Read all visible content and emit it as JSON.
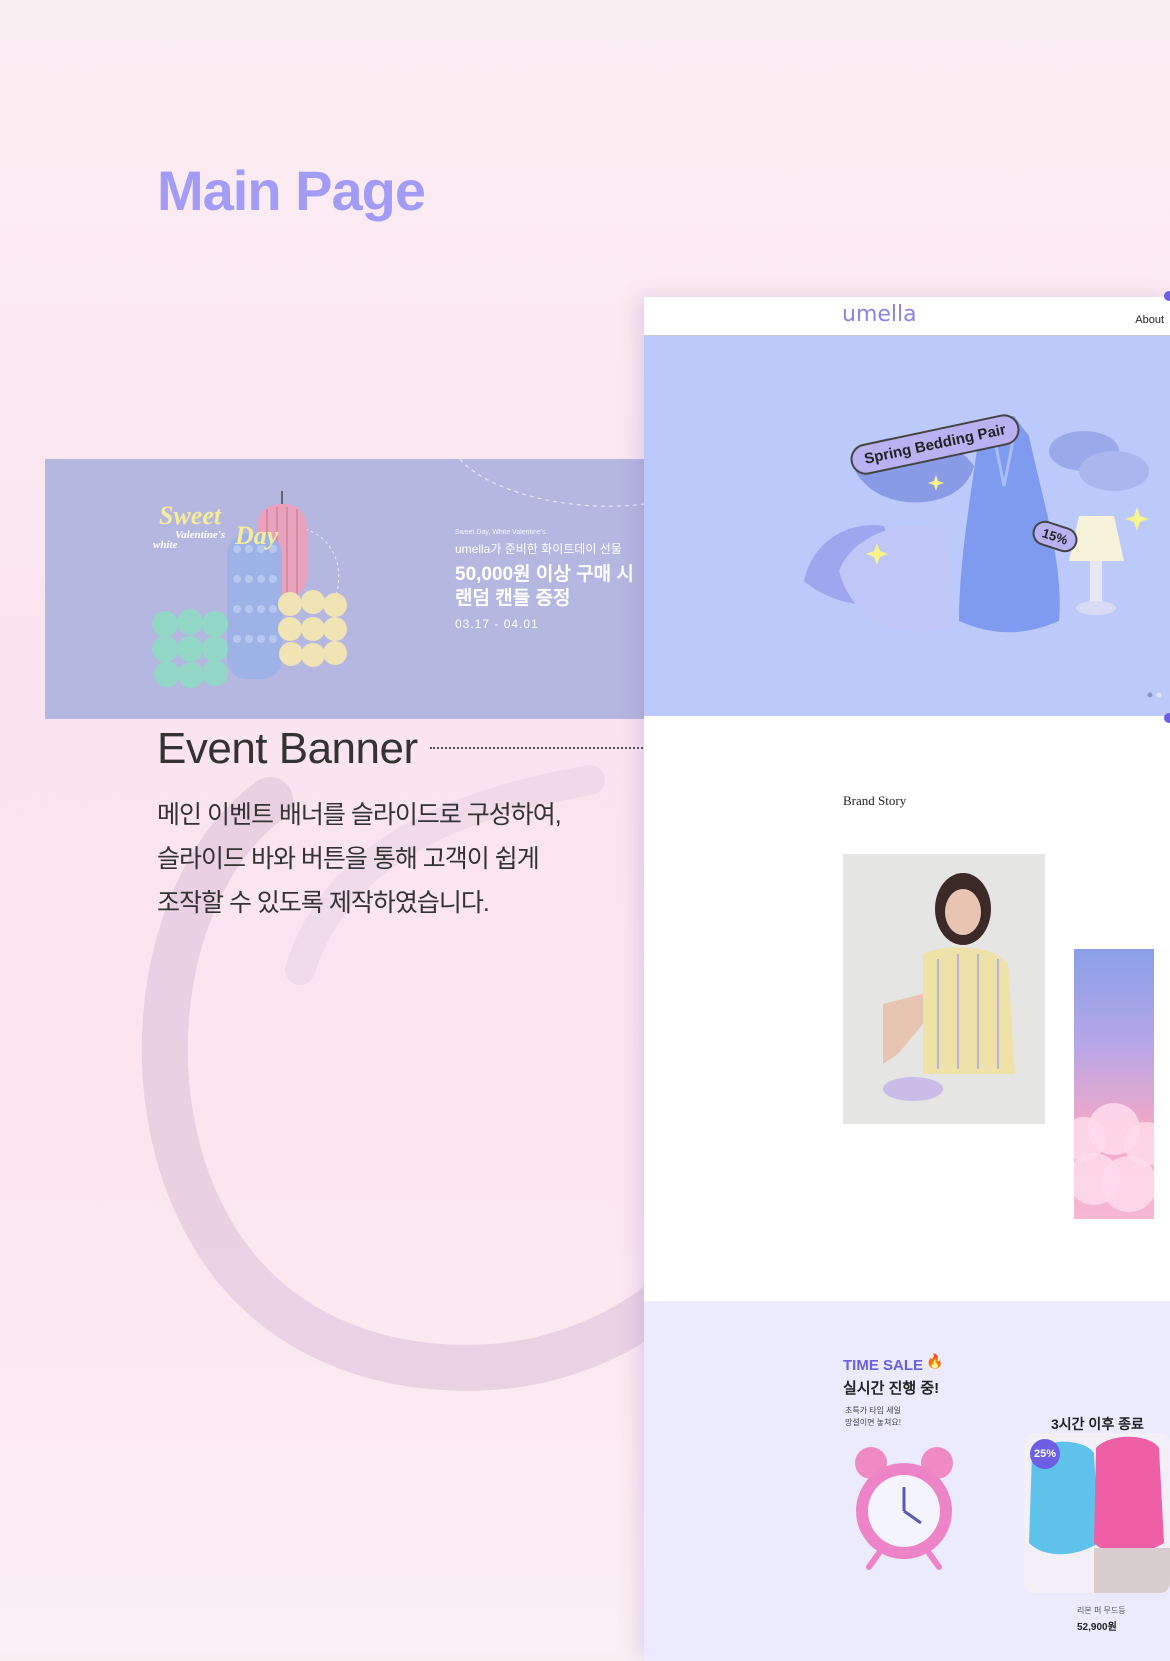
{
  "page": {
    "heading": "Main Page"
  },
  "event_banner": {
    "script_title_1": "Sweet",
    "script_title_2": "Day",
    "script_valentine": "Valentine's",
    "script_white": "white",
    "small_caption": "Sweet Day, White Valentine's",
    "subtitle": "umella가 준비한 화이트데이 선물",
    "headline_1": "50,000원 이상 구매 시",
    "headline_2": "랜덤 캔들 증정",
    "date_range": "03.17 - 04.01"
  },
  "section": {
    "title": "Event Banner",
    "description_1": "메인 이벤트 배너를 슬라이드로 구성하여,",
    "description_2": "슬라이드 바와 버튼을 통해 고객이 쉽게",
    "description_3": "조작할 수 있도록 제작하였습니다."
  },
  "mockup": {
    "logo": "umella",
    "nav_about": "About",
    "hero_pill": "Spring Bedding Pair",
    "hero_badge": "15%",
    "brand_story": "Brand Story",
    "time_sale": {
      "title": "TIME SALE",
      "subtitle": "실시간 진행 중!",
      "note_1": "초특가 타임 세일",
      "note_2": "망설이면 놓쳐요!",
      "ends": "3시간 이후 종료",
      "discount_badge": "25%",
      "product_name": "리본 퍼 무드등",
      "product_price": "52,900원"
    }
  },
  "colors": {
    "heading": "#a29cf6",
    "event_bg": "#b4b7df",
    "hero_bg": "#bccafb",
    "accent": "#6c5fe4",
    "timesale_bg": "#ecebfd"
  }
}
